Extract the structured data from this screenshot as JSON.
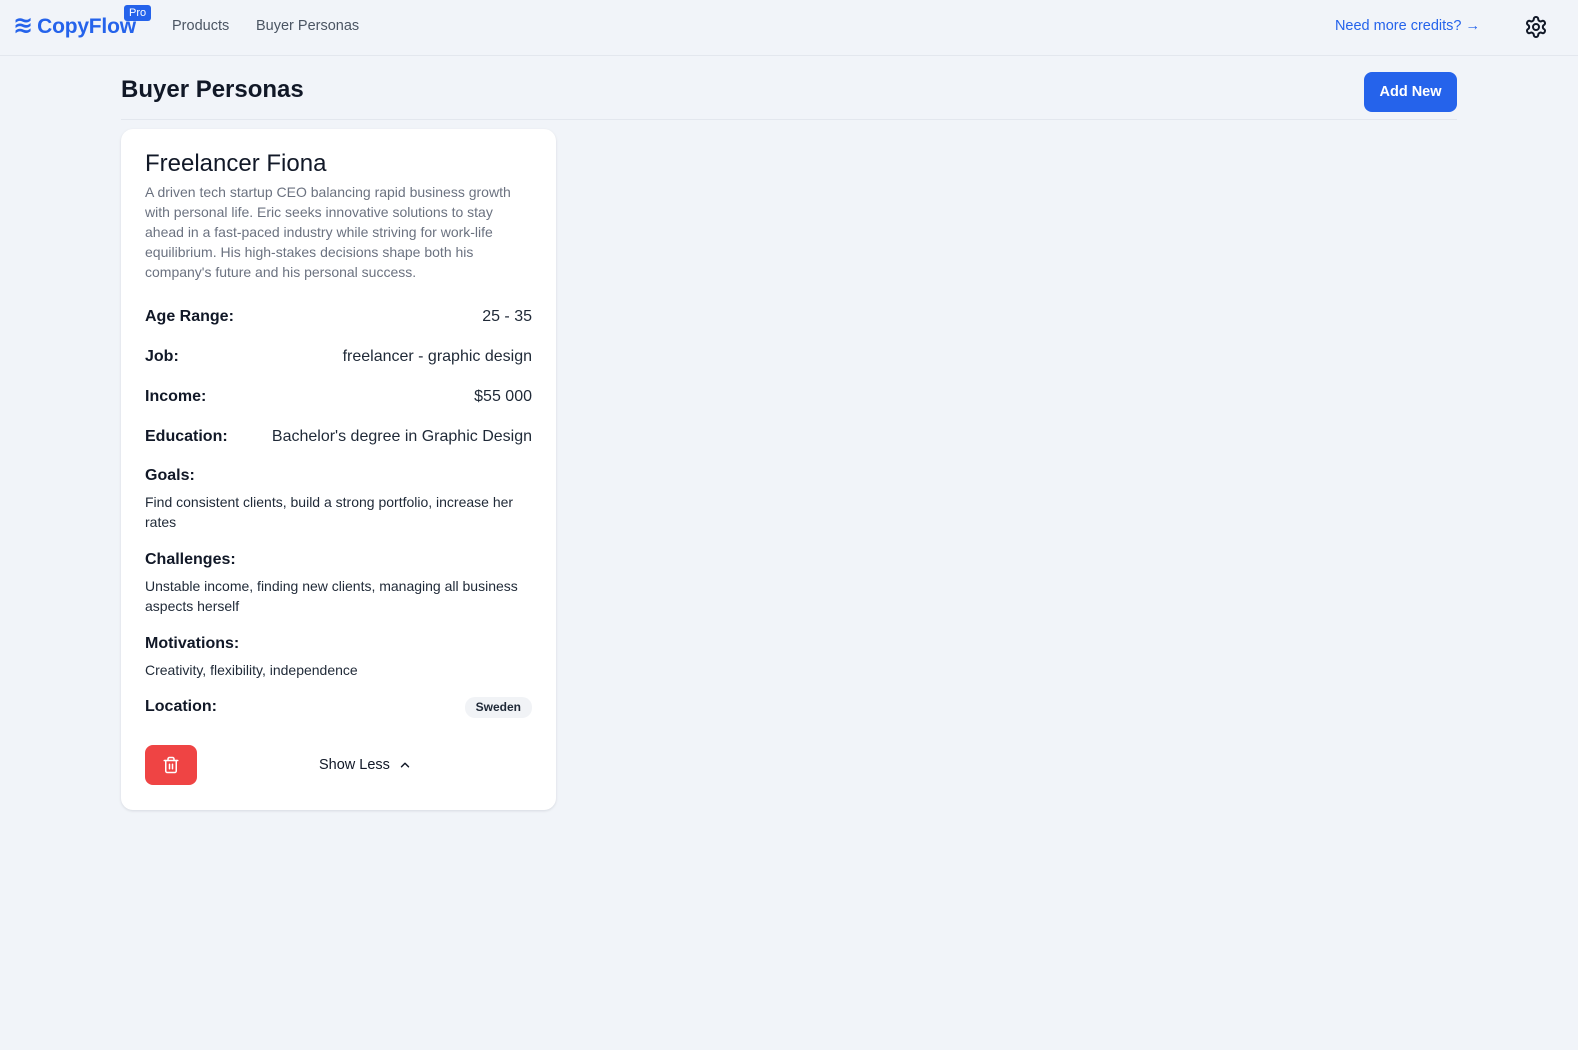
{
  "topbar": {
    "brand_mark": "≋",
    "brand_name": "CopyFlow",
    "pro_badge": "Pro",
    "nav": [
      {
        "label": "Products"
      },
      {
        "label": "Buyer Personas"
      }
    ],
    "credits_link": "Need more credits? →",
    "settings_icon": "gear-icon"
  },
  "page": {
    "title": "Buyer Personas",
    "add_new_label": "Add New"
  },
  "persona": {
    "name": "Freelancer Fiona",
    "description": "A driven tech startup CEO balancing rapid business growth with personal life. Eric seeks innovative solutions to stay ahead in a fast-paced industry while striving for work-life equilibrium. His high-stakes decisions shape both his company's future and his personal success.",
    "attributes": [
      {
        "label": "Age Range:",
        "value": "25 - 35"
      },
      {
        "label": "Job:",
        "value": "freelancer - graphic design"
      },
      {
        "label": "Income:",
        "value": "$55 000"
      },
      {
        "label": "Education:",
        "value": "Bachelor's degree in Graphic Design"
      }
    ],
    "goals": {
      "label": "Goals:",
      "text": "Find consistent clients, build a strong portfolio, increase her rates"
    },
    "challenges": {
      "label": "Challenges:",
      "text": "Unstable income, finding new clients, managing all business aspects herself"
    },
    "motivations": {
      "label": "Motivations:",
      "text": "Creativity, flexibility, independence"
    },
    "location": {
      "label": "Location:",
      "value": "Sweden"
    },
    "delete_icon": "trash-icon",
    "show_less_label": "Show Less",
    "show_less_icon": "chevron-up-icon",
    "delete_color": "#ef4444"
  },
  "colors": {
    "accent": "#2563eb",
    "background": "#f1f4f9",
    "danger": "#ef4444"
  }
}
